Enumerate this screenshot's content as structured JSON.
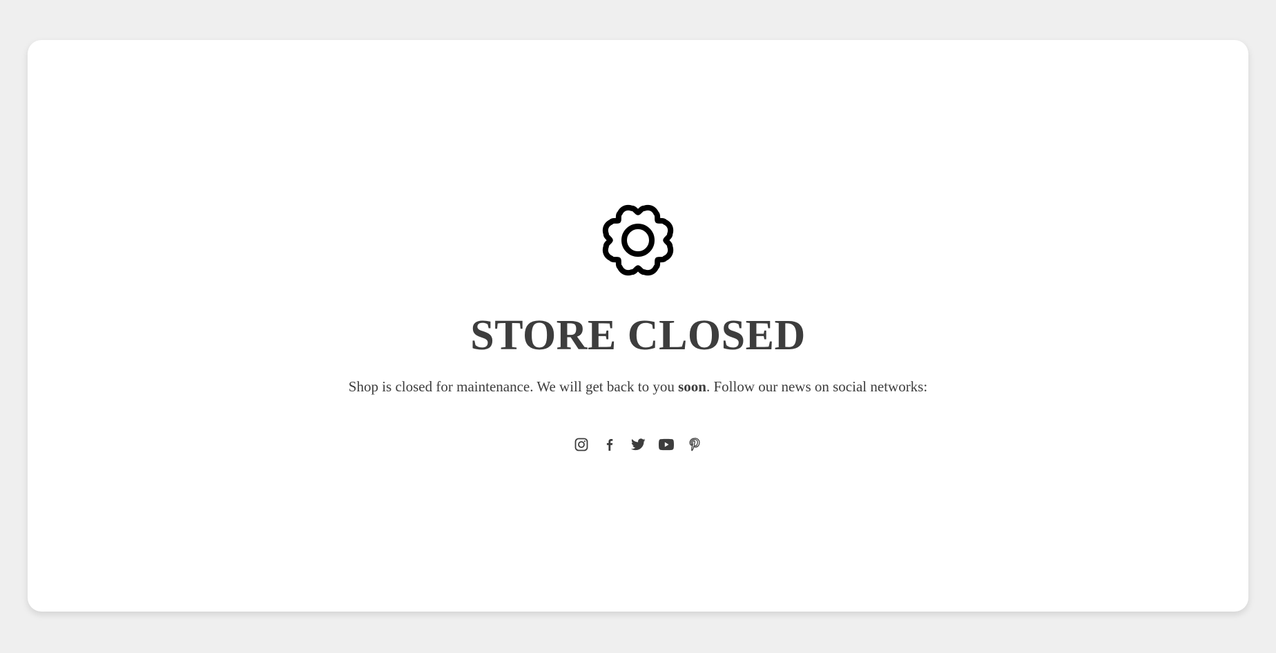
{
  "store": {
    "title": "STORE CLOSED",
    "message_before": "Shop is closed for maintenance. We will get back to you ",
    "message_bold": "soon",
    "message_after": ". Follow our news on social networks:"
  },
  "icons": {
    "main": "gear-icon",
    "social": [
      "instagram-icon",
      "facebook-icon",
      "twitter-icon",
      "youtube-icon",
      "pinterest-icon"
    ]
  },
  "colors": {
    "background": "#efefef",
    "card": "#ffffff",
    "text": "#3d3d3d",
    "icon": "#000000"
  }
}
